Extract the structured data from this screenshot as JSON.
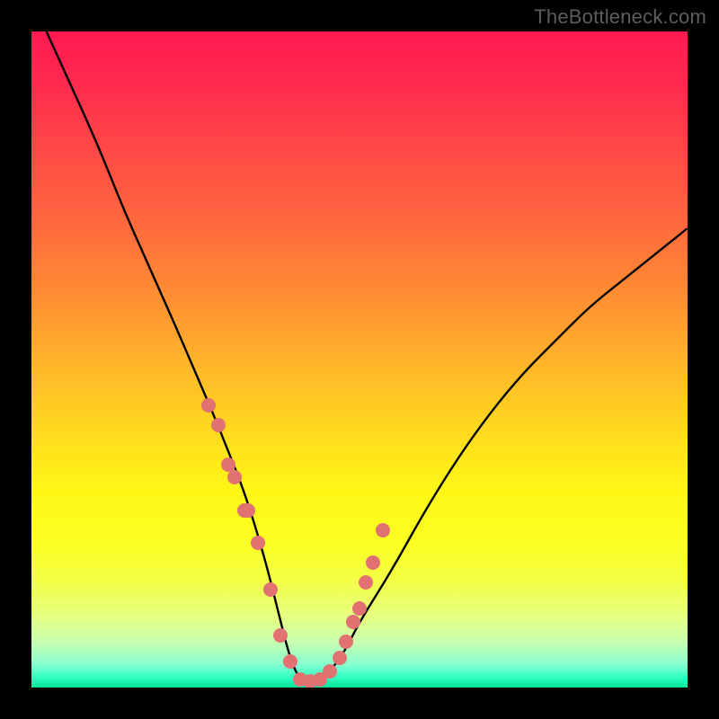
{
  "watermark": "TheBottleneck.com",
  "colors": {
    "background": "#000000",
    "dot": "#e27272",
    "curve": "#000000"
  },
  "chart_data": {
    "type": "line",
    "title": "",
    "xlabel": "",
    "ylabel": "",
    "xlim": [
      0,
      100
    ],
    "ylim": [
      0,
      100
    ],
    "curve": {
      "x": [
        0,
        5,
        10,
        14,
        18,
        22,
        25,
        28,
        30,
        32,
        34,
        36,
        37.5,
        39,
        40,
        41,
        42,
        44,
        46,
        48,
        50,
        55,
        60,
        65,
        70,
        75,
        80,
        85,
        90,
        95,
        100
      ],
      "y": [
        105,
        94,
        83,
        73,
        64,
        55,
        48,
        41,
        36,
        31,
        25,
        18,
        12,
        6,
        3,
        1.2,
        0.8,
        1.5,
        3,
        6,
        10,
        18,
        27,
        35,
        42,
        48,
        53,
        58,
        62,
        66,
        70
      ]
    },
    "dots": {
      "x": [
        27,
        28.5,
        30,
        31,
        32.5,
        33,
        34.5,
        36.5,
        38,
        39.5,
        41,
        42.5,
        44,
        45.5,
        47,
        48,
        49,
        50,
        51,
        52,
        53.5
      ],
      "y": [
        43,
        40,
        34,
        32,
        27,
        27,
        22,
        15,
        8,
        4,
        1.2,
        1.0,
        1.3,
        2.5,
        4.5,
        7,
        10,
        12,
        16,
        19,
        24
      ]
    }
  }
}
